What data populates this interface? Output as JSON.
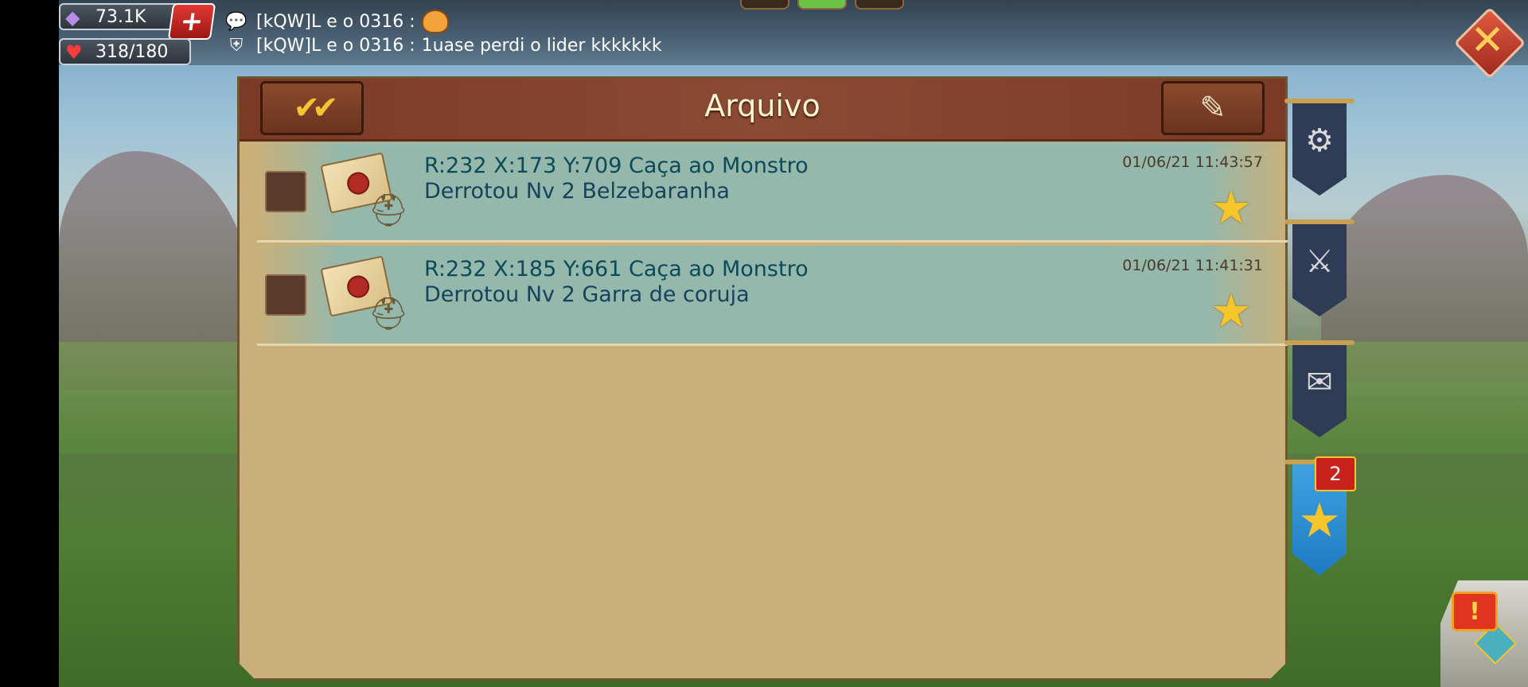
{
  "resources": {
    "gems": "73.1K",
    "stamina": "318/180",
    "add_label": "+"
  },
  "chat": [
    {
      "sender": "[kQW]L e o 0316 :",
      "message": ""
    },
    {
      "sender": "[kQW]L e o 0316 :",
      "message": "1uase perdi o lider kkkkkkk"
    }
  ],
  "close_label": "✕",
  "panel": {
    "title": "Arquivo"
  },
  "mails": [
    {
      "title": "R:232 X:173 Y:709 Caça ao Monstro",
      "subtitle": "Derrotou Nv 2 Belzebaranha",
      "time": "01/06/21 11:43:57"
    },
    {
      "title": "R:232 X:185 Y:661 Caça ao Monstro",
      "subtitle": "Derrotou Nv 2 Garra de coruja",
      "time": "01/06/21 11:41:31"
    }
  ],
  "tabs": {
    "favorites_badge": "2"
  },
  "icons": {
    "gems": "gem-icon",
    "stamina": "heart-icon",
    "star": "star-icon",
    "mark_read": "double-check-icon",
    "compose": "scroll-quill-icon"
  },
  "colors": {
    "panel_bg": "#c9b07a",
    "header_bg": "#7a3a26",
    "row_bg": "#8cb9b4",
    "title_text": "#0a4a5a",
    "star": "#f5c52a",
    "badge": "#c9221c",
    "active_tab": "#3fa3e0"
  }
}
